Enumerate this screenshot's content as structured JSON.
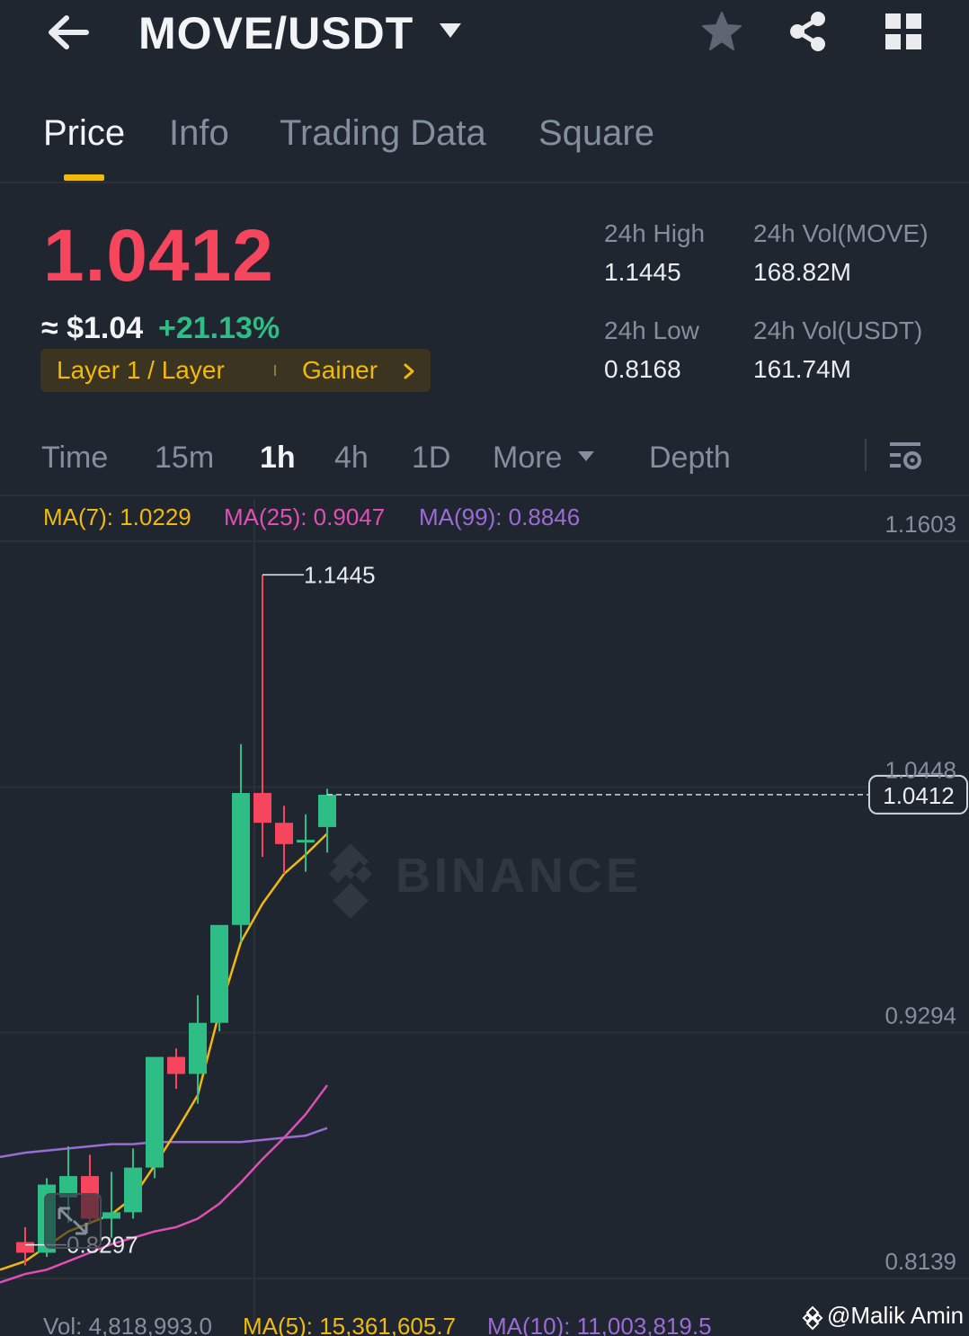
{
  "header": {
    "title": "MOVE/USDT"
  },
  "tabs": [
    {
      "label": "Price"
    },
    {
      "label": "Info"
    },
    {
      "label": "Trading Data"
    },
    {
      "label": "Square"
    }
  ],
  "price": {
    "last": "1.0412",
    "fiat": "≈ $1.04",
    "change_pct": "+21.13%",
    "tag_category": "Layer 1 / Layer",
    "tag_status": "Gainer"
  },
  "stats": {
    "high_label": "24h High",
    "high_value": "1.1445",
    "low_label": "24h Low",
    "low_value": "0.8168",
    "vol_move_label": "24h Vol(MOVE)",
    "vol_move_value": "168.82M",
    "vol_usdt_label": "24h Vol(USDT)",
    "vol_usdt_value": "161.74M"
  },
  "intervals": [
    {
      "label": "Time"
    },
    {
      "label": "15m"
    },
    {
      "label": "1h"
    },
    {
      "label": "4h"
    },
    {
      "label": "1D"
    },
    {
      "label": "More"
    },
    {
      "label": "Depth"
    }
  ],
  "ma": {
    "ma7": "MA(7): 1.0229",
    "ma25": "MA(25): 0.9047",
    "ma99": "MA(99): 0.8846"
  },
  "volume": {
    "vol": "Vol: 4,818,993.0",
    "ma5": "MA(5): 15,361,605.7",
    "ma10": "MA(10): 11,003,819.5"
  },
  "watermark": "@Malik Amin",
  "colors": {
    "up": "#2ebd85",
    "down": "#f6465d",
    "accent": "#f0b90b",
    "ma7": "#f0b90b",
    "ma25": "#e04fb3",
    "ma99": "#9b6bd6"
  },
  "chart_data": {
    "type": "candlestick",
    "interval": "1h",
    "watermark": "BINANCE",
    "ylim": [
      0.8139,
      1.1603
    ],
    "y_ticks": [
      "1.1603",
      "1.0448",
      "0.9294",
      "0.8139"
    ],
    "last_price": 1.0412,
    "high_marker": 1.1445,
    "low_marker": 0.8297,
    "candles": [
      {
        "o": 0.831,
        "h": 0.838,
        "c": 0.826,
        "l": 0.82
      },
      {
        "o": 0.826,
        "h": 0.861,
        "c": 0.858,
        "l": 0.824
      },
      {
        "o": 0.852,
        "h": 0.876,
        "c": 0.862,
        "l": 0.84
      },
      {
        "o": 0.862,
        "h": 0.872,
        "c": 0.842,
        "l": 0.84
      },
      {
        "o": 0.842,
        "h": 0.864,
        "c": 0.845,
        "l": 0.833
      },
      {
        "o": 0.845,
        "h": 0.875,
        "c": 0.866,
        "l": 0.842
      },
      {
        "o": 0.866,
        "h": 0.909,
        "c": 0.918,
        "l": 0.861
      },
      {
        "o": 0.918,
        "h": 0.922,
        "c": 0.91,
        "l": 0.903
      },
      {
        "o": 0.91,
        "h": 0.947,
        "c": 0.934,
        "l": 0.896
      },
      {
        "o": 0.934,
        "h": 0.979,
        "c": 0.98,
        "l": 0.93
      },
      {
        "o": 0.98,
        "h": 1.065,
        "c": 1.042,
        "l": 0.972
      },
      {
        "o": 1.042,
        "h": 1.1445,
        "c": 1.028,
        "l": 1.012
      },
      {
        "o": 1.028,
        "h": 1.036,
        "c": 1.018,
        "l": 1.004
      },
      {
        "o": 1.019,
        "h": 1.032,
        "c": 1.02,
        "l": 1.005
      },
      {
        "o": 1.026,
        "h": 1.044,
        "c": 1.0412,
        "l": 1.014
      }
    ],
    "ma7_line": [
      0.822,
      0.829,
      0.836,
      0.84,
      0.844,
      0.852,
      0.867,
      0.883,
      0.9,
      0.939,
      0.972,
      0.99,
      1.004,
      1.013,
      1.0229
    ],
    "ma25_line": [
      0.816,
      0.818,
      0.822,
      0.826,
      0.83,
      0.833,
      0.836,
      0.838,
      0.842,
      0.849,
      0.859,
      0.87,
      0.88,
      0.891,
      0.9047
    ],
    "ma99_line": [
      0.873,
      0.874,
      0.875,
      0.876,
      0.877,
      0.877,
      0.878,
      0.878,
      0.878,
      0.878,
      0.878,
      0.879,
      0.88,
      0.881,
      0.8846
    ]
  }
}
